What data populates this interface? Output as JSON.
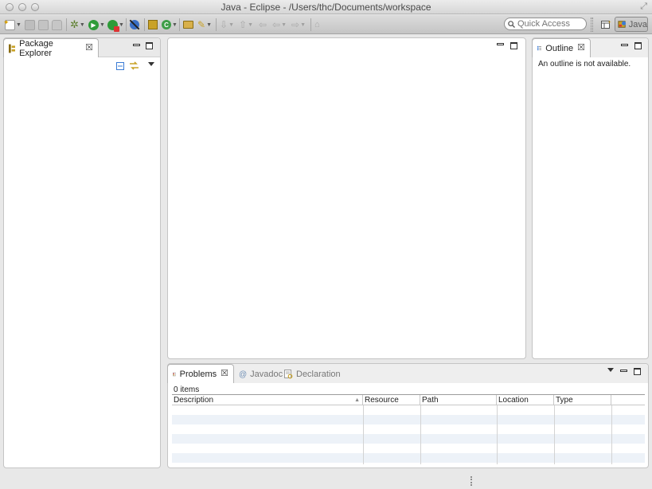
{
  "window": {
    "title": "Java - Eclipse - /Users/thc/Documents/workspace"
  },
  "toolbar": {
    "quick_access_placeholder": "Quick Access",
    "perspective_label": "Java"
  },
  "package_explorer": {
    "tab_label": "Package Explorer"
  },
  "outline": {
    "tab_label": "Outline",
    "message": "An outline is not available."
  },
  "bottom_panel": {
    "tabs": [
      {
        "label": "Problems"
      },
      {
        "label": "Javadoc"
      },
      {
        "label": "Declaration"
      }
    ],
    "items_count": "0 items",
    "columns": [
      "Description",
      "Resource",
      "Path",
      "Location",
      "Type"
    ]
  },
  "colors": {
    "accent_icon_yellow": "#c9a227",
    "accent_icon_blue": "#3a7bd5",
    "run_green": "#2e9b38",
    "stripe": "#edf2f8"
  },
  "icons": [
    "new-wizard-icon",
    "save-icon",
    "save-all-icon",
    "print-icon",
    "debug-icon",
    "run-icon",
    "coverage-icon",
    "skip-breakpoints-icon",
    "new-java-package-icon",
    "new-java-class-icon",
    "open-type-icon",
    "search-icon",
    "next-annotation-icon",
    "previous-annotation-icon",
    "back-icon",
    "forward-icon",
    "pin-editor-icon",
    "open-perspective-icon",
    "java-perspective-icon"
  ]
}
